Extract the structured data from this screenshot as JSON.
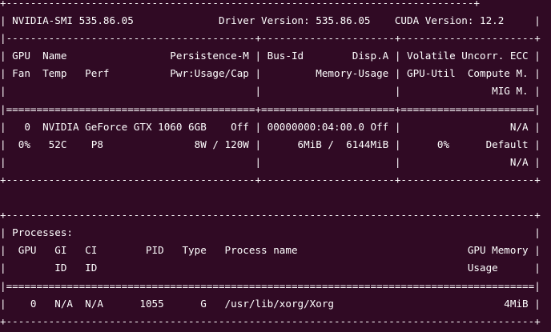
{
  "terminal": {
    "lines": [
      "+-----------------------------------------------------------------------------+",
      "| NVIDIA-SMI 535.86.05              Driver Version: 535.86.05    CUDA Version: 12.2     |",
      "|-----------------------------------------+----------------------+----------------------+",
      "| GPU  Name                 Persistence-M | Bus-Id        Disp.A | Volatile Uncorr. ECC |",
      "| Fan  Temp   Perf          Pwr:Usage/Cap |         Memory-Usage | GPU-Util  Compute M. |",
      "|                                         |                      |               MIG M. |",
      "|=========================================+======================+======================|",
      "|   0  NVIDIA GeForce GTX 1060 6GB    Off | 00000000:04:00.0 Off |                  N/A |",
      "|  0%   52C    P8               8W / 120W |      6MiB /  6144MiB |      0%      Default |",
      "|                                         |                      |                  N/A |",
      "+-----------------------------------------+----------------------+----------------------+",
      "",
      "+---------------------------------------------------------------------------------------+",
      "| Processes:                                                                            |",
      "|  GPU   GI   CI        PID   Type   Process name                            GPU Memory |",
      "|        ID   ID                                                             Usage      |",
      "|=======================================================================================|",
      "|    0   N/A  N/A      1055      G   /usr/lib/xorg/Xorg                            4MiB |",
      "+---------------------------------------------------------------------------------------+"
    ]
  },
  "colors": {
    "background": "#300a24",
    "foreground": "#ffffff"
  }
}
